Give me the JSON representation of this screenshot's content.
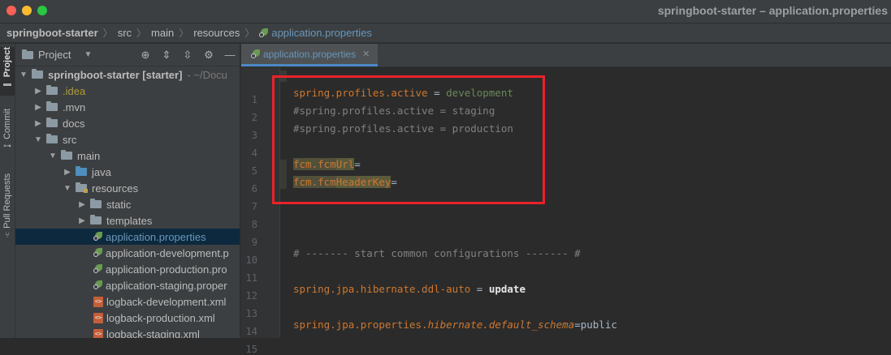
{
  "window": {
    "title": "springboot-starter – application.properties"
  },
  "breadcrumb": {
    "items": [
      "springboot-starter",
      "src",
      "main",
      "resources",
      "application.properties"
    ]
  },
  "stripe": {
    "project": "Project",
    "commit": "Commit",
    "pull_requests": "Pull Requests"
  },
  "project_panel": {
    "title": "Project",
    "tree": [
      {
        "label": "springboot-starter [starter]",
        "suffix": "- ~/Docu"
      },
      {
        "label": ".idea"
      },
      {
        "label": ".mvn"
      },
      {
        "label": "docs"
      },
      {
        "label": "src"
      },
      {
        "label": "main"
      },
      {
        "label": "java"
      },
      {
        "label": "resources"
      },
      {
        "label": "static"
      },
      {
        "label": "templates"
      },
      {
        "label": "application.properties"
      },
      {
        "label": "application-development.p"
      },
      {
        "label": "application-production.pro"
      },
      {
        "label": "application-staging.proper"
      },
      {
        "label": "logback-development.xml"
      },
      {
        "label": "logback-production.xml"
      },
      {
        "label": "logback-staging.xml"
      }
    ]
  },
  "editor": {
    "tab_label": "application.properties",
    "line_numbers": [
      "1",
      "2",
      "3",
      "4",
      "5",
      "6",
      "7",
      "8",
      "9",
      "10",
      "11",
      "12",
      "13",
      "14",
      "15"
    ],
    "code": {
      "l2": {
        "key": "spring.profiles.active",
        "eq": " = ",
        "val": "development"
      },
      "l3": "#spring.profiles.active = staging",
      "l4": "#spring.profiles.active = production",
      "l6": {
        "key": "fcm.fcm",
        "key2": "Url",
        "eq": "="
      },
      "l7": {
        "key": "fcm.fcm",
        "key2": "HeaderKey",
        "eq": "="
      },
      "l11": "# ------- start common configurations ------- #",
      "l13": {
        "key": "spring.jpa.hibernate.ddl-auto",
        "eq": " = ",
        "val": "update"
      },
      "l15": {
        "key": "spring.jpa.properties.",
        "key2": "hibernate.default_schema",
        "eq": "=",
        "val": "public"
      }
    }
  },
  "colors": {
    "annotation": "#e8232a",
    "selection": "#0d293e",
    "accent": "#4a88c7"
  }
}
